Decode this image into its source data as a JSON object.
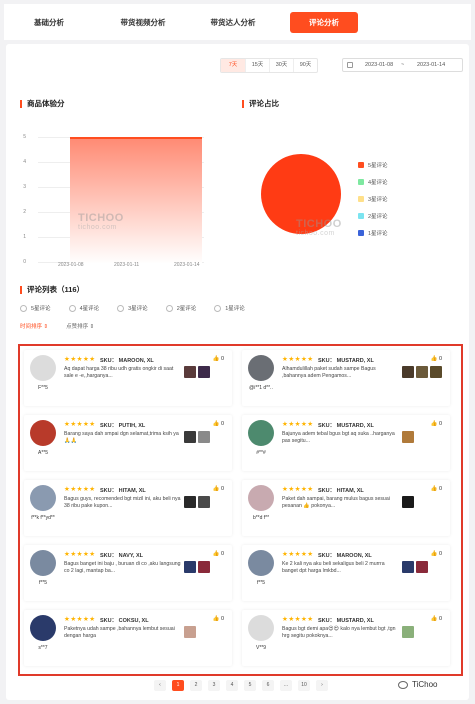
{
  "tabs": [
    "基础分析",
    "带货视频分析",
    "带货达人分析",
    "评论分析"
  ],
  "range": [
    "7天",
    "15天",
    "30天",
    "90天"
  ],
  "date_range": {
    "start": "2023-01-08",
    "sep": "~",
    "end": "2023-01-14"
  },
  "score_title": "商品体验分",
  "ratio_title": "评论占比",
  "watermark": {
    "main": "TICHOO",
    "sub": "tichoo.com"
  },
  "colors": {
    "accent": "#ff4d1f",
    "pie": "#ff3b14"
  },
  "chart_data": {
    "type": "area",
    "title": "商品体验分",
    "x_ticks": [
      "2023-01-08",
      "2023-01-11",
      "2023-01-14"
    ],
    "y_ticks": [
      "5",
      "4",
      "3",
      "2",
      "1",
      "0"
    ],
    "x": [
      "2023-01-08",
      "2023-01-14"
    ],
    "values": [
      4.6,
      4.6
    ],
    "ylim": [
      0,
      5
    ]
  },
  "pie_chart": {
    "type": "pie",
    "title": "评论占比",
    "legend": [
      {
        "label": "5星评论",
        "color": "#ff4d1f"
      },
      {
        "label": "4星评论",
        "color": "#7ee8a0"
      },
      {
        "label": "3星评论",
        "color": "#ffe08a"
      },
      {
        "label": "2星评论",
        "color": "#7be4f0"
      },
      {
        "label": "1星评论",
        "color": "#3a63d9"
      }
    ]
  },
  "reviews": {
    "title": "评论列表（116）",
    "filters": [
      "5星评论",
      "4星评论",
      "3星评论",
      "2星评论",
      "1星评论"
    ],
    "sorts": [
      "时间排序 ⇕",
      "点赞排序 ⇕"
    ],
    "items": [
      {
        "user": "F**5",
        "stars": "★★★★★",
        "sku": "SKU：  MAROON, XL",
        "likes": "0",
        "text": "Aq dapat harga 38 ribu udh gratis ongkir di saat sale e -e,,harganya...",
        "avatar": "#dcdcdc",
        "photos": [
          "#5a3b3b",
          "#3d2a4a"
        ]
      },
      {
        "user": "@i**1 d**..",
        "stars": "★★★★★",
        "sku": "SKU：  MUSTARD, XL",
        "likes": "0",
        "text": "Alhamdulillah paket sudah sampe Bagus ,bahannya adem Pengamos...",
        "avatar": "#6a6e74",
        "photos": [
          "#4a3a2a",
          "#6b5a3a",
          "#5a4a2a"
        ]
      },
      {
        "user": "A**5",
        "stars": "★★★★★",
        "sku": "SKU：  PUTIH, XL",
        "likes": "0",
        "text": "Barang saya dah smpai dgn selamat,trima ksih ya🙏🙏",
        "avatar": "#b83a2a",
        "photos": [
          "#3a3a3a",
          "#8a8a8a"
        ]
      },
      {
        "user": "#**#",
        "stars": "★★★★★",
        "sku": "SKU：  MUSTARD, XL",
        "likes": "0",
        "text": "Bajunya adem tebal bgus bgt aq suka ..harganya pas segitu...",
        "avatar": "#4d8a6e",
        "photos": [
          "#b07a3a"
        ]
      },
      {
        "user": "f**k f**yd**",
        "stars": "★★★★★",
        "sku": "SKU：  HITAM, XL",
        "likes": "0",
        "text": "Bagus guys, recomended bgt mizil ini, aku beli nya 38 ribu pake kupon...",
        "avatar": "#8a9ab0",
        "photos": [
          "#2a2a2a",
          "#4a4a4a"
        ]
      },
      {
        "user": "b**d f**",
        "stars": "★★★★★",
        "sku": "SKU：  HITAM, XL",
        "likes": "0",
        "text": "Paket dah sampai, barang mulus bagus sesuai pesanan 👍 pokonya...",
        "avatar": "#c8aab0",
        "photos": [
          "#1a1a1a"
        ]
      },
      {
        "user": "f**5",
        "stars": "★★★★★",
        "sku": "SKU：  NAVY, XL",
        "likes": "0",
        "text": "Bagus banget ini baju , buruan di co ,aku langsung co 2 lagi, mantap ba...",
        "avatar": "#7a8aa0",
        "photos": [
          "#2a3a6a",
          "#8a2a3a"
        ]
      },
      {
        "user": "f**5",
        "stars": "★★★★★",
        "sku": "SKU：  MAROON, XL",
        "likes": "0",
        "text": "Ke 2 kali nya aku beli sekaligus beli 2 murrra banget dpt harga lmkbd...",
        "avatar": "#7a8aa0",
        "photos": [
          "#2a3a6a",
          "#8a2a3a"
        ]
      },
      {
        "user": "s**7",
        "stars": "★★★★★",
        "sku": "SKU：  COKSU, XL",
        "likes": "0",
        "text": "Paketnya udah sampe ,bahannya lembut sesuai dengan harga",
        "avatar": "#2a3a6a",
        "photos": [
          "#c8a090"
        ]
      },
      {
        "user": "V**9",
        "stars": "★★★★★",
        "sku": "SKU：  MUSTARD, XL",
        "likes": "0",
        "text": "Bagus bgt demi apa😍😍 kalo nya lembut bgt ,tgn hrg segitu pokoknya...",
        "avatar": "#dcdcdc",
        "photos": [
          "#8ab07a"
        ]
      }
    ]
  },
  "pager": [
    "‹",
    "1",
    "2",
    "3",
    "4",
    "5",
    "6",
    "...",
    "10",
    "›"
  ],
  "brand": "TiChoo"
}
